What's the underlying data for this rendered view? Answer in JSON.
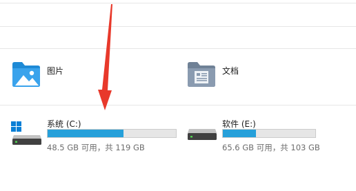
{
  "folders": [
    {
      "label": "图片",
      "icon": "pictures-folder-icon"
    },
    {
      "label": "文档",
      "icon": "documents-folder-icon"
    }
  ],
  "drives": [
    {
      "name": "系统 (C:)",
      "detail": "48.5 GB 可用，共 119 GB",
      "used_fraction": 0.59,
      "icon": "system-drive-icon"
    },
    {
      "name": "软件 (E:)",
      "detail": "65.6 GB 可用，共 103 GB",
      "used_fraction": 0.36,
      "icon": "hard-drive-icon"
    }
  ],
  "colors": {
    "usage_fill": "#26a0da",
    "usage_track": "#e6e6e6",
    "annotation_arrow": "#e8392b",
    "pictures_folder": "#1e8ad6",
    "documents_folder": "#8494a6"
  }
}
